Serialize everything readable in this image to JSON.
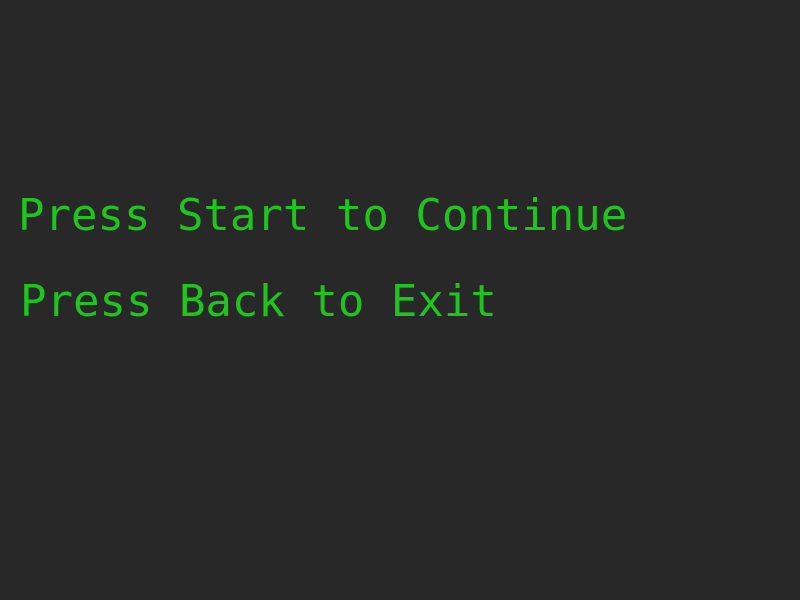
{
  "screen": {
    "background_color": "#282828",
    "text_color": "#1fc41f",
    "start_prompt": "Press Start to Continue",
    "back_prompt": "Press Back to Exit"
  }
}
